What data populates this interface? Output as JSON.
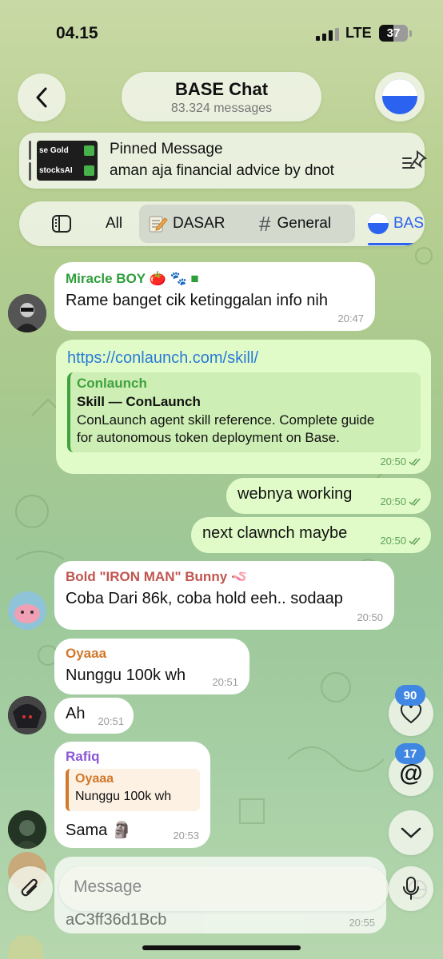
{
  "status_bar": {
    "time": "04.15",
    "network": "LTE",
    "battery": "37"
  },
  "header": {
    "title": "BASE Chat",
    "subtitle": "83.324 messages"
  },
  "pinned": {
    "label": "Pinned Message",
    "text": "aman aja financial advice by dnot",
    "thumb_lines": [
      "se Gold",
      "stocksAI"
    ]
  },
  "tabs": [
    {
      "label": "All"
    },
    {
      "label": "DASAR"
    },
    {
      "label": "General"
    },
    {
      "label": "BAS"
    }
  ],
  "messages": [
    {
      "sender": "Miracle BOY 🍅 🐾 ■",
      "text": "Rame banget cik ketinggalan info nih",
      "time": "20:47"
    },
    {
      "link": "https://conlaunch.com/skill/",
      "preview_site": "Conlaunch",
      "preview_title": "Skill — ConLaunch",
      "preview_desc_1": "ConLaunch agent skill reference. Complete guide",
      "preview_desc_2": "for autonomous token deployment on Base.",
      "time": "20:50"
    },
    {
      "text": "webnya working",
      "time": "20:50"
    },
    {
      "text": "next clawnch maybe",
      "time": "20:50"
    },
    {
      "sender": "Bold \"IRON MAN\" Bunny 🪱",
      "text": "Coba Dari 86k, coba hold eeh.. sodaap",
      "time": "20:50"
    },
    {
      "sender": "Oyaaa",
      "text": "Nunggu 100k wh",
      "time": "20:51"
    },
    {
      "text": "Ah",
      "time": "20:51"
    },
    {
      "sender": "Rafiq",
      "reply_sender": "Oyaaa",
      "reply_text": "Nunggu 100k wh",
      "text": "Sama 🗿",
      "time": "20:53"
    },
    {
      "text": "aC3ff36d1Bcb",
      "time": "20:55"
    }
  ],
  "side": {
    "reactions_count": "90",
    "mentions_count": "17"
  },
  "input": {
    "placeholder": "Message"
  },
  "colors": {
    "link": "#2a7ad8",
    "outgoing_time": "#5ea35a",
    "badge": "#3f87e3",
    "miracle": "#2e9e3a",
    "bunny": "#c0554f",
    "oyaaa": "#d0782b",
    "rafiq": "#8a57d6"
  }
}
